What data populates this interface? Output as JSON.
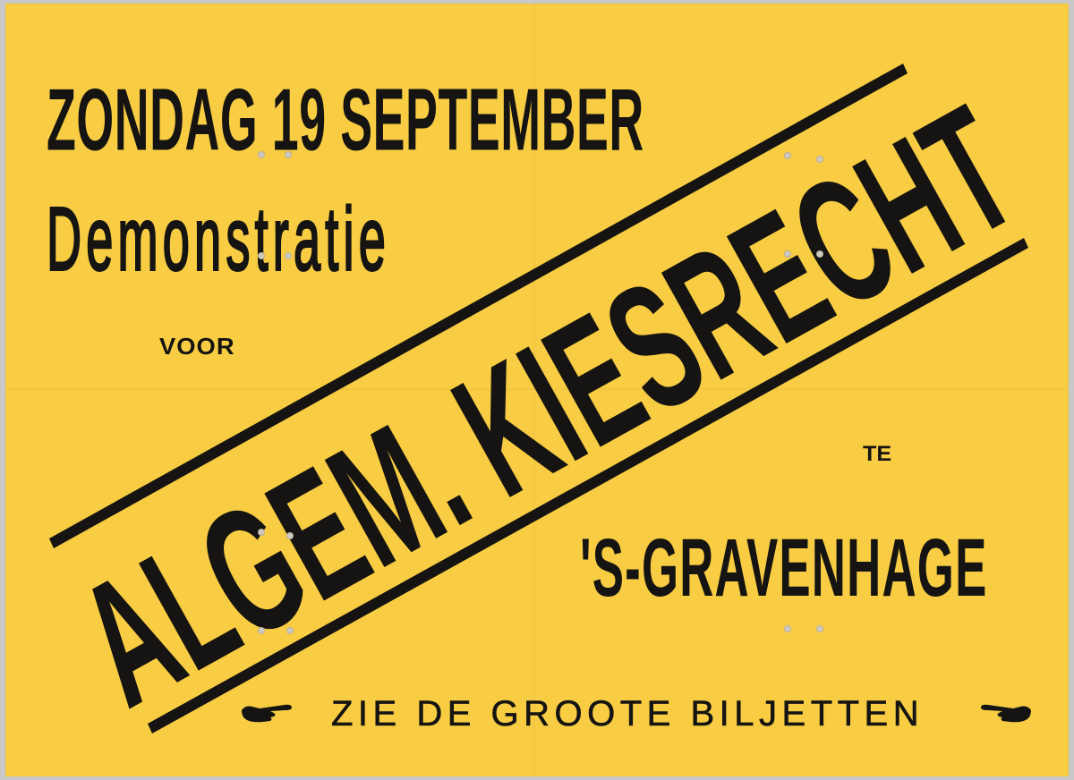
{
  "poster": {
    "background_color": "#f8cd43",
    "ink_color": "#151412",
    "line1": "ZONDAG 19 SEPTEMBER",
    "line2": "Demonstratie",
    "line3": "VOOR",
    "banner": "ALGEM. KIESRECHT",
    "line5": "TE",
    "line6": "'S-GRAVENHAGE",
    "footer": "ZIE DE GROOTE BILJETTEN",
    "footer_icons": [
      "pointing-hand-right-icon",
      "pointing-hand-left-icon"
    ]
  }
}
